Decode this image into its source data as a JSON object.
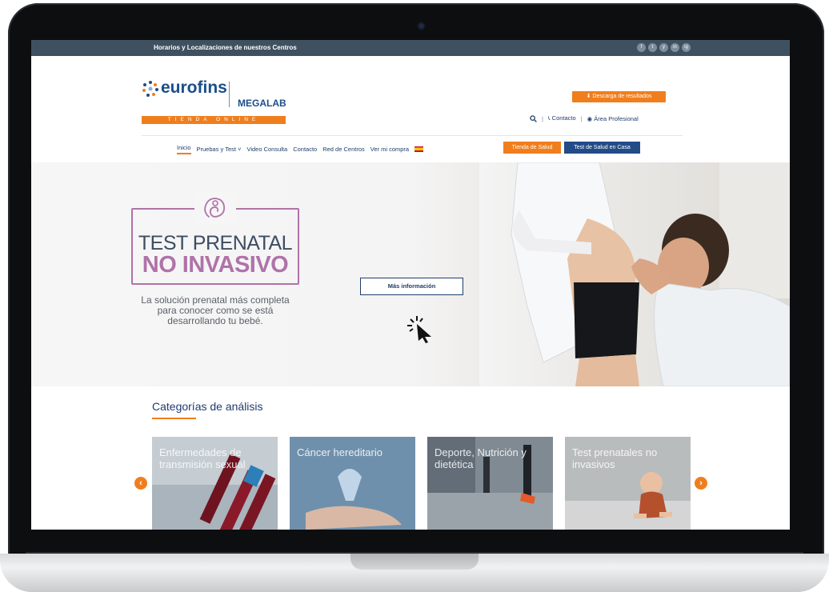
{
  "topbar": {
    "link": "Horarios y Localizaciones de nuestros Centros",
    "social": [
      "f",
      "t",
      "y",
      "in",
      "ig"
    ]
  },
  "logo": {
    "brand": "eurofins",
    "sub": "MEGALAB",
    "band": "TIENDA ONLINE"
  },
  "header": {
    "download_label": "Descarga de resultados",
    "sep": "|",
    "contact_label": "Contacto",
    "professional_label": "Área Profesional"
  },
  "nav": {
    "items": [
      "Inicio",
      "Pruebas y Test ˅",
      "Video Consulta",
      "Contacto",
      "Red de Centros",
      "Ver mi compra"
    ],
    "tienda_label": "Tienda de Salud",
    "casa_label": "Test de Salud en Casa"
  },
  "hero": {
    "title_line1": "TEST PRENATAL",
    "title_line2": "NO INVASIVO",
    "description": "La solución prenatal más completa para conocer como se está desarrollando tu bebé.",
    "more_button": "Más información"
  },
  "categories": {
    "title": "Categorías de análisis",
    "prev": "‹",
    "next": "›",
    "cards": [
      {
        "label": "Enfermedades de transmisión sexual"
      },
      {
        "label": "Cáncer hereditario"
      },
      {
        "label": "Deporte, Nutrición y dietética"
      },
      {
        "label": "Test prenatales no invasivos"
      }
    ]
  },
  "colors": {
    "accent": "#f07e1d",
    "brand": "#1f3d6e",
    "prenatal": "#b072a9",
    "topbar": "#3f5160"
  }
}
